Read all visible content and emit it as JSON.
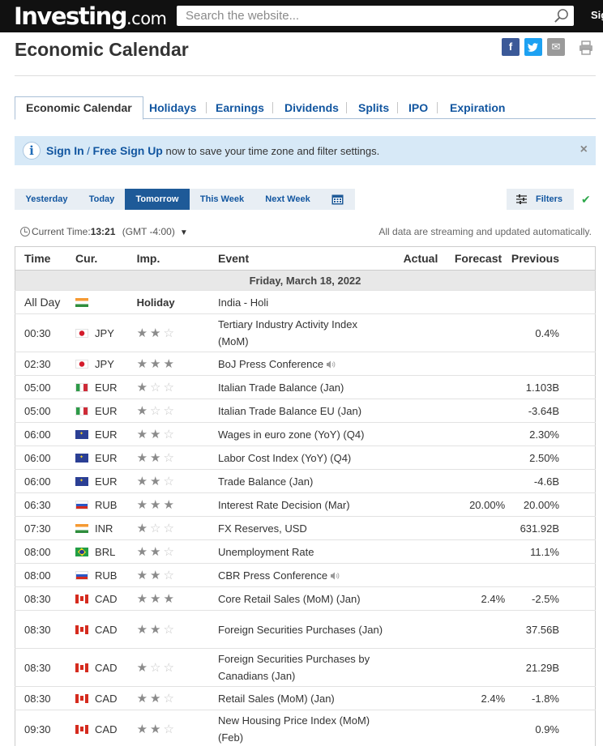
{
  "topbar": {
    "logo_main": "Investing",
    "logo_suffix": ".com",
    "search_placeholder": "Search the website...",
    "signin": "Sign In"
  },
  "header": {
    "title": "Economic Calendar",
    "share": [
      "f",
      "t",
      "✉"
    ]
  },
  "subtabs": [
    "Economic Calendar",
    "Holidays",
    "Earnings",
    "Dividends",
    "Splits",
    "IPO",
    "Expiration"
  ],
  "banner": {
    "sign_in": "Sign In",
    "slash": " / ",
    "free_sign_up": "Free Sign Up",
    "text": " now to save your time zone and filter settings.",
    "close": "×"
  },
  "datetabs": [
    "Yesterday",
    "Today",
    "Tomorrow",
    "This Week",
    "Next Week"
  ],
  "filters_label": "Filters",
  "time_row": {
    "label": "Current Time:",
    "time": "13:21",
    "tz": "(GMT -4:00)",
    "streaming": "All data are streaming and updated automatically."
  },
  "table": {
    "headers": {
      "time": "Time",
      "cur": "Cur.",
      "imp": "Imp.",
      "event": "Event",
      "actual": "Actual",
      "forecast": "Forecast",
      "previous": "Previous"
    },
    "date": "Friday, March 18, 2022",
    "holiday": {
      "time": "All Day",
      "label": "Holiday",
      "event": "India - Holi"
    },
    "rows": [
      {
        "time": "00:30",
        "cur": "JPY",
        "imp": 2,
        "event": "Tertiary Industry Activity Index (MoM)",
        "actual": "",
        "forecast": "",
        "previous": "0.4%"
      },
      {
        "time": "02:30",
        "cur": "JPY",
        "imp": 3,
        "event": "BoJ Press Conference",
        "actual": "",
        "forecast": "",
        "previous": ""
      },
      {
        "time": "05:00",
        "cur": "EUR",
        "imp": 1,
        "event": "Italian Trade Balance (Jan)",
        "actual": "",
        "forecast": "",
        "previous": "1.103B"
      },
      {
        "time": "05:00",
        "cur": "EUR",
        "imp": 1,
        "event": "Italian Trade Balance EU (Jan)",
        "actual": "",
        "forecast": "",
        "previous": "-3.64B"
      },
      {
        "time": "06:00",
        "cur": "EUR",
        "imp": 2,
        "event": "Wages in euro zone (YoY) (Q4)",
        "actual": "",
        "forecast": "",
        "previous": "2.30%"
      },
      {
        "time": "06:00",
        "cur": "EUR",
        "imp": 2,
        "event": "Labor Cost Index (YoY) (Q4)",
        "actual": "",
        "forecast": "",
        "previous": "2.50%"
      },
      {
        "time": "06:00",
        "cur": "EUR",
        "imp": 2,
        "event": "Trade Balance (Jan)",
        "actual": "",
        "forecast": "",
        "previous": "-4.6B"
      },
      {
        "time": "06:30",
        "cur": "RUB",
        "imp": 3,
        "event": "Interest Rate Decision (Mar)",
        "actual": "",
        "forecast": "20.00%",
        "previous": "20.00%"
      },
      {
        "time": "07:30",
        "cur": "INR",
        "imp": 1,
        "event": "FX Reserves, USD",
        "actual": "",
        "forecast": "",
        "previous": "631.92B"
      },
      {
        "time": "08:00",
        "cur": "BRL",
        "imp": 2,
        "event": "Unemployment Rate",
        "actual": "",
        "forecast": "",
        "previous": "11.1%"
      },
      {
        "time": "08:00",
        "cur": "RUB",
        "imp": 2,
        "event": "CBR Press Conference",
        "actual": "",
        "forecast": "",
        "previous": ""
      },
      {
        "time": "08:30",
        "cur": "CAD",
        "imp": 3,
        "event": "Core Retail Sales (MoM) (Jan)",
        "actual": "",
        "forecast": "2.4%",
        "previous": "-2.5%"
      },
      {
        "time": "08:30",
        "cur": "CAD",
        "imp": 2,
        "event": "Foreign Securities Purchases (Jan)",
        "actual": "",
        "forecast": "",
        "previous": "37.56B"
      },
      {
        "time": "08:30",
        "cur": "CAD",
        "imp": 1,
        "event": "Foreign Securities Purchases by Canadians (Jan)",
        "actual": "",
        "forecast": "",
        "previous": "21.29B"
      },
      {
        "time": "08:30",
        "cur": "CAD",
        "imp": 2,
        "event": "Retail Sales (MoM) (Jan)",
        "actual": "",
        "forecast": "2.4%",
        "previous": "-1.8%"
      },
      {
        "time": "09:30",
        "cur": "CAD",
        "imp": 2,
        "event": "New Housing Price Index (MoM) (Feb)",
        "actual": "",
        "forecast": "",
        "previous": "0.9%"
      }
    ]
  }
}
